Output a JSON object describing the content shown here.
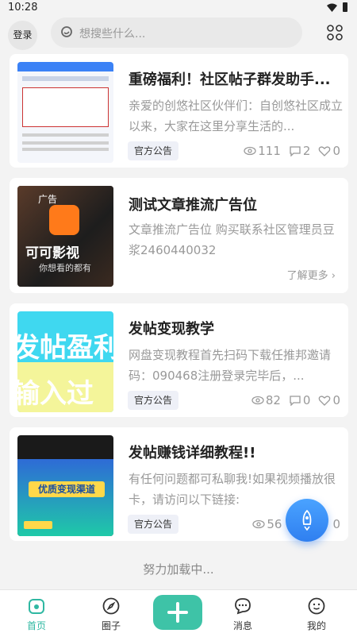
{
  "status": {
    "time": "10:28"
  },
  "header": {
    "login_label": "登录",
    "search_placeholder": "想搜些什么..."
  },
  "posts": [
    {
      "title": "重磅福利！社区帖子群发助手...",
      "desc": "亲爱的创悠社区伙伴们：自创悠社区成立以来，大家在这里分享生活的...",
      "tag": "官方公告",
      "views": "111",
      "comments": "2",
      "likes": "0"
    },
    {
      "title": "测试文章推流广告位",
      "desc": "文章推流广告位 购买联系社区管理员豆浆2460440032",
      "ad_badge": "广告",
      "ad_brand": "可可影视",
      "ad_slogan": "你想看的都有",
      "more": "了解更多"
    },
    {
      "title": "发帖变现教学",
      "desc": "网盘变现教程首先扫码下载任推邦邀请码：090468注册登录完毕后，...",
      "tag": "官方公告",
      "views": "82",
      "comments": "0",
      "likes": "0",
      "thumb_text_top": "发帖盈利",
      "thumb_text_bottom": "输入过"
    },
    {
      "title": "发帖赚钱详细教程!!",
      "desc": "有任何问题都可私聊我!如果视频播放很卡，请访问以下链接:",
      "tag": "官方公告",
      "views": "56",
      "likes": "0",
      "thumb_text": "优质变现渠道"
    }
  ],
  "loading_text": "努力加载中...",
  "nav": {
    "home": "首页",
    "circle": "圈子",
    "messages": "消息",
    "mine": "我的"
  },
  "colors": {
    "accent": "#3ec3a7",
    "fab": "#2f7ff0"
  }
}
